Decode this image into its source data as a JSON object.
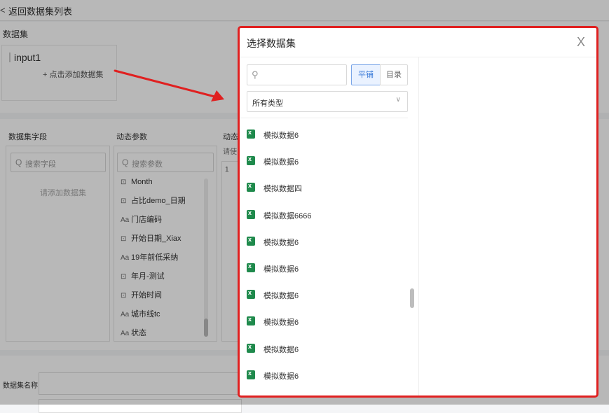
{
  "header": {
    "back_arrow": "<",
    "back_label": "返回数据集列表"
  },
  "dataset_section": {
    "title": "数据集",
    "card_name": "input1",
    "add_label": "+ 点击添加数据集"
  },
  "fields_panel": {
    "title": "数据集字段",
    "search_placeholder": "搜索字段",
    "empty_text": "请添加数据集"
  },
  "params_panel": {
    "title": "动态参数",
    "search_placeholder": "搜索参数",
    "items": [
      {
        "icon": "date-icon",
        "glyph": "⊡",
        "label": "Month"
      },
      {
        "icon": "date-icon",
        "glyph": "⊡",
        "label": "占比demo_日期"
      },
      {
        "icon": "text-icon",
        "glyph": "Aa",
        "label": "门店编码"
      },
      {
        "icon": "date-icon",
        "glyph": "⊡",
        "label": "开始日期_Xiax"
      },
      {
        "icon": "text-icon",
        "glyph": "Aa",
        "label": "19年前低采纳"
      },
      {
        "icon": "date-icon",
        "glyph": "⊡",
        "label": "年月-测试"
      },
      {
        "icon": "date-icon",
        "glyph": "⊡",
        "label": "开始时间"
      },
      {
        "icon": "text-icon",
        "glyph": "Aa",
        "label": "城市线tc"
      },
      {
        "icon": "text-icon",
        "glyph": "Aa",
        "label": "状态"
      }
    ]
  },
  "sql_panel": {
    "title": "动态",
    "hint": "请使",
    "line_number": "1"
  },
  "bottom": {
    "name_label": "数据集名称"
  },
  "modal": {
    "title": "选择数据集",
    "close_glyph": "X",
    "search_icon": "⚲",
    "tab_flat": "平铺",
    "tab_dir": "目录",
    "type_select": "所有类型",
    "type_chevron": "∨",
    "datasets": [
      "模拟数据6",
      "模拟数据6",
      "模拟数据四",
      "模拟数据6666",
      "模拟数据6",
      "模拟数据6",
      "模拟数据6",
      "模拟数据6",
      "模拟数据6",
      "模拟数据6"
    ]
  },
  "colors": {
    "annotation": "#e02020",
    "accent": "#3b7bd8",
    "excel_green": "#1f8a4c"
  }
}
